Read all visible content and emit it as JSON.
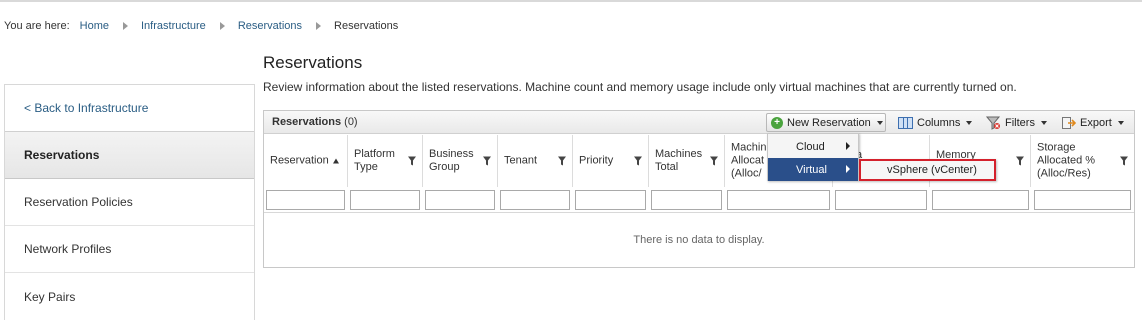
{
  "breadcrumb": {
    "prefix": "You are here:",
    "items": [
      "Home",
      "Infrastructure",
      "Reservations"
    ],
    "current": "Reservations"
  },
  "sidebar": {
    "back": "< Back to Infrastructure",
    "items": [
      {
        "label": "Reservations",
        "active": true
      },
      {
        "label": "Reservation Policies"
      },
      {
        "label": "Network Profiles"
      },
      {
        "label": "Key Pairs"
      }
    ]
  },
  "page": {
    "title": "Reservations",
    "description": "Review information about the listed reservations. Machine count and memory usage include only virtual machines that are currently turned on."
  },
  "grid": {
    "title": "Reservations",
    "count": "(0)",
    "toolbar": {
      "new_reservation": "New Reservation",
      "columns": "Columns",
      "filters": "Filters",
      "export": "Export"
    },
    "columns": [
      {
        "l1": "Reservation",
        "l2": "",
        "l3": "",
        "sorted": "asc"
      },
      {
        "l1": "Platform",
        "l2": "Type",
        "l3": ""
      },
      {
        "l1": "Business",
        "l2": "Group",
        "l3": ""
      },
      {
        "l1": "Tenant",
        "l2": "",
        "l3": ""
      },
      {
        "l1": "Priority",
        "l2": "",
        "l3": ""
      },
      {
        "l1": "Machines",
        "l2": "Total",
        "l3": ""
      },
      {
        "l1": "Machin",
        "l2": "Allocat",
        "l3": "(Alloc/"
      },
      {
        "l1": "ta",
        "l2": "",
        "l3": ""
      },
      {
        "l1": "Memory",
        "l2": "",
        "l3": ""
      },
      {
        "l1": "Storage",
        "l2": "Allocated %",
        "l3": "(Alloc/Res)"
      }
    ],
    "empty_message": "There is no data to display."
  },
  "new_reservation_menu": {
    "items": [
      {
        "label": "Cloud",
        "has_submenu": true
      },
      {
        "label": "Virtual",
        "has_submenu": true,
        "highlighted": true
      }
    ],
    "virtual_submenu": {
      "items": [
        {
          "label": "vSphere (vCenter)",
          "highlighted_with_box": true
        }
      ]
    }
  },
  "colors": {
    "link": "#2a5d84",
    "menu_highlight": "#2a4f8a",
    "annotation_box": "#d4212c",
    "add_icon": "#4aa33d"
  }
}
